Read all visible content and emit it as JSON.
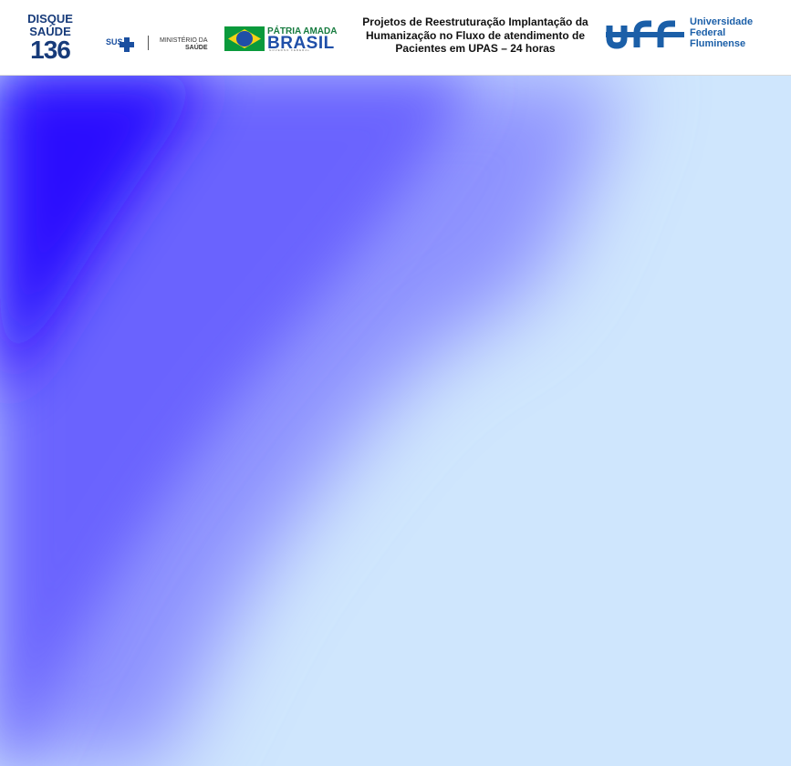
{
  "header": {
    "disque": {
      "line1": "DISQUE",
      "line2": "SAÚDE",
      "number": "136"
    },
    "sus": {
      "text": "SUS"
    },
    "ministry": {
      "line1": "MINISTÉRIO DA",
      "line2": "SAÚDE"
    },
    "patria": {
      "line1": "PÁTRIA AMADA",
      "line2": "BRASIL",
      "line3": "GOVERNO FEDERAL"
    },
    "title": {
      "line1": "Projetos de Reestruturação Implantação da",
      "line2": "Humanização no Fluxo de atendimento de",
      "line3": "Pacientes em UPAS – 24 horas"
    },
    "uff": {
      "line1": "Universidade",
      "line2": "Federal",
      "line3": "Fluminense"
    }
  },
  "colors": {
    "light_blue": "#cfe6fd",
    "deep_blue": "#2a10fe",
    "mid_blue": "#6b63fe",
    "uff_blue": "#1b5fa8",
    "disque_blue": "#173b7a"
  }
}
